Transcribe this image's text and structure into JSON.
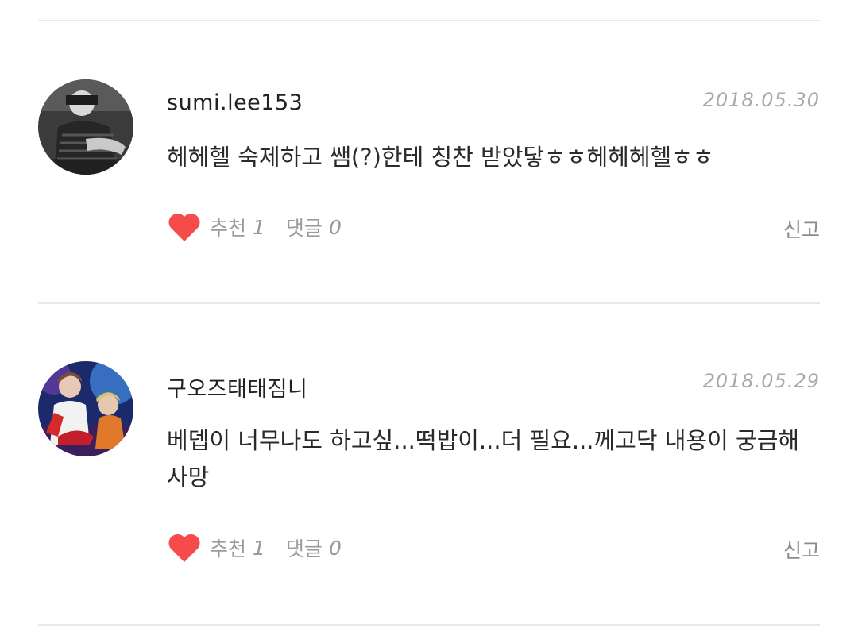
{
  "comments": [
    {
      "username": "sumi.lee153",
      "date": "2018.05.30",
      "text": "헤헤헬 숙제하고 쌤(?)한테 칭찬 받았닿ㅎㅎ헤헤헤헬ㅎㅎ",
      "like_label": "추천",
      "like_count": "1",
      "reply_label": "댓글",
      "reply_count": "0",
      "report_label": "신고",
      "avatar_icon": "profile-photo"
    },
    {
      "username": "구오즈태태짐니",
      "date": "2018.05.29",
      "text": "베뎁이 너무나도 하고싶...떡밥이...더 필요...께고닥 내용이 궁금해사망",
      "like_label": "추천",
      "like_count": "1",
      "reply_label": "댓글",
      "reply_count": "0",
      "report_label": "신고",
      "avatar_icon": "profile-photo"
    }
  ],
  "colors": {
    "heart": "#f54b4b",
    "divider": "#e9e9e9",
    "meta_text": "#9a9a9a"
  }
}
